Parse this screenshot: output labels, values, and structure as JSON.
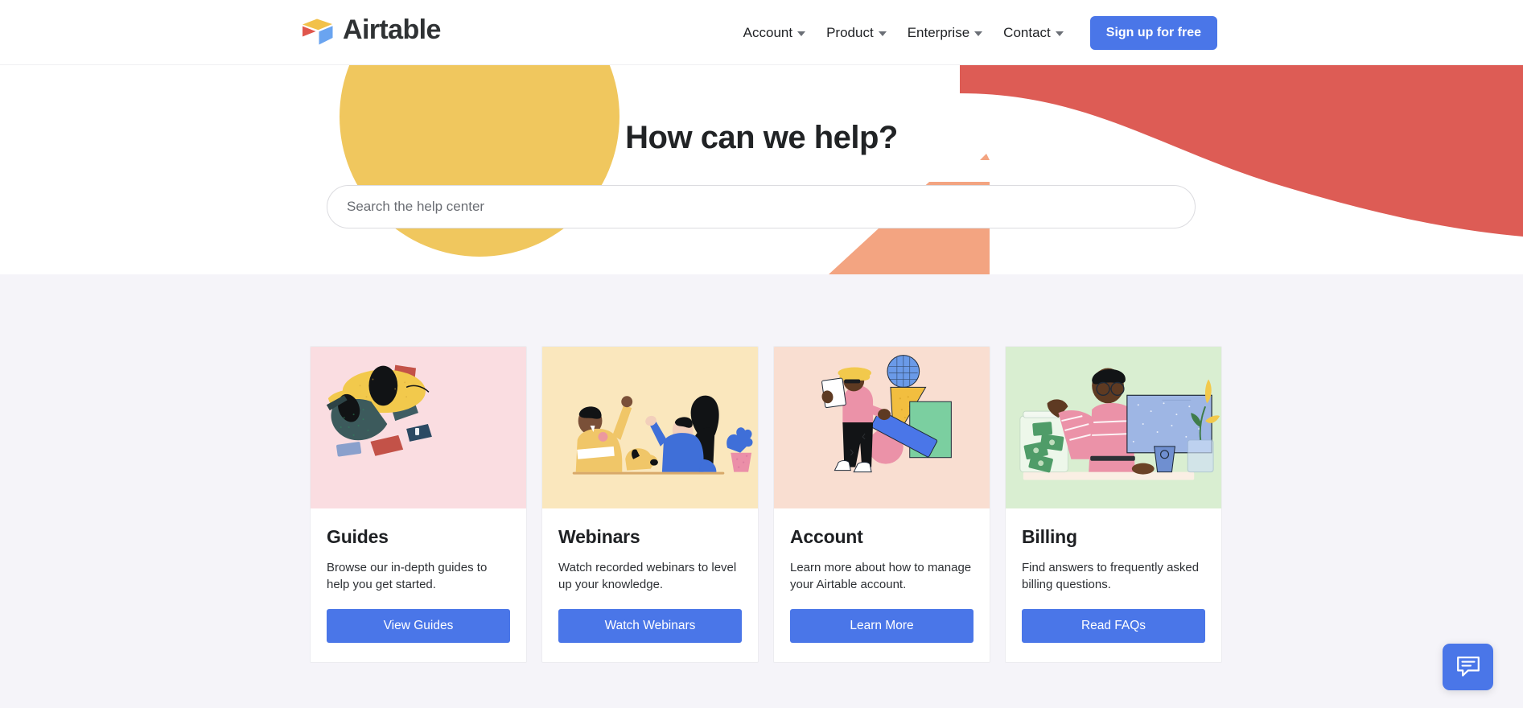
{
  "header": {
    "logo": {
      "name": "Airtable",
      "icon": "airtable-logo-icon"
    },
    "nav_items": [
      {
        "label": "Account",
        "has_caret": true
      },
      {
        "label": "Product",
        "has_caret": true
      },
      {
        "label": "Enterprise",
        "has_caret": true
      },
      {
        "label": "Contact",
        "has_caret": true
      }
    ],
    "signup_label": "Sign up for free",
    "accent_color": "#4a76e8"
  },
  "hero": {
    "title": "How can we help?",
    "search_placeholder": "Search the help center",
    "search_value": "",
    "shapes": {
      "circle_color": "#f0c75e",
      "wave_color": "#dd5c55",
      "triangle_color": "#f3a481"
    }
  },
  "cards": [
    {
      "title": "Guides",
      "description": "Browse our in-depth guides to help you get started.",
      "button_label": "View Guides",
      "illustration": "person-reading-books-illustration",
      "bg_color": "#fadde1"
    },
    {
      "title": "Webinars",
      "description": "Watch recorded webinars to level up your knowledge.",
      "button_label": "Watch Webinars",
      "illustration": "people-at-table-with-dog-illustration",
      "bg_color": "#fae7bd"
    },
    {
      "title": "Account",
      "description": "Learn more about how to manage your Airtable account.",
      "button_label": "Learn More",
      "illustration": "person-with-clipboard-shapes-illustration",
      "bg_color": "#f9ded1"
    },
    {
      "title": "Billing",
      "description": "Find answers to frequently asked billing questions.",
      "button_label": "Read FAQs",
      "illustration": "person-at-monitor-money-jar-illustration",
      "bg_color": "#d9eed1"
    }
  ],
  "chat": {
    "icon": "chat-bubble-icon",
    "color": "#4a76e8"
  },
  "page": {
    "hero_bg": "#ffffff",
    "section_bg": "#f5f4f9"
  }
}
